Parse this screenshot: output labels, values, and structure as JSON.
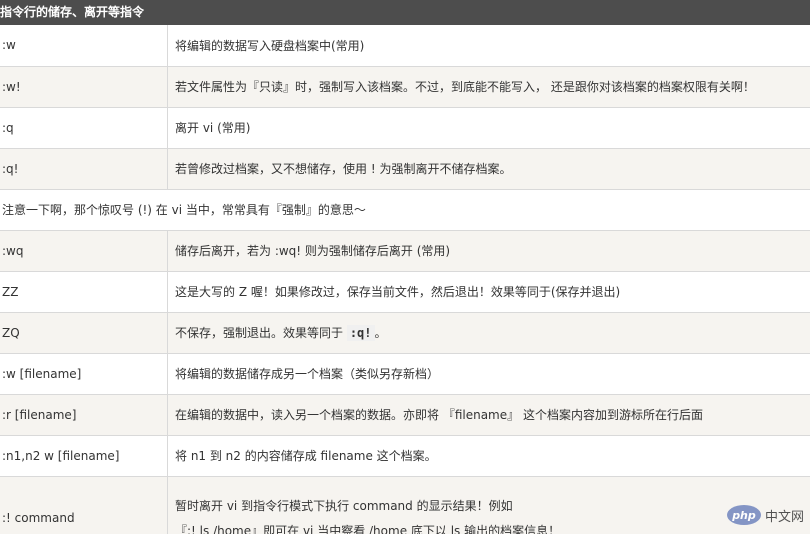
{
  "header": {
    "title": "指令行的储存、离开等指令"
  },
  "rows": [
    {
      "cmd": ":w",
      "desc": "将编辑的数据写入硬盘档案中(常用)"
    },
    {
      "cmd": ":w!",
      "desc": "若文件属性为『只读』时，强制写入该档案。不过，到底能不能写入， 还是跟你对该档案的档案权限有关啊！"
    },
    {
      "cmd": ":q",
      "desc": "离开 vi (常用)"
    },
    {
      "cmd": ":q!",
      "desc": "若曾修改过档案，又不想储存，使用 ! 为强制离开不储存档案。"
    },
    {
      "note": "注意一下啊，那个惊叹号 (!) 在 vi 当中，常常具有『强制』的意思～"
    },
    {
      "cmd": ":wq",
      "desc": "储存后离开，若为 :wq! 则为强制储存后离开 (常用)"
    },
    {
      "cmd": "ZZ",
      "desc": "这是大写的 Z 喔！如果修改过，保存当前文件，然后退出！效果等同于(保存并退出)"
    },
    {
      "cmd": "ZQ",
      "desc_before": "不保存，强制退出。效果等同于 ",
      "desc_code": ":q!",
      "desc_after": "。"
    },
    {
      "cmd": ":w [filename]",
      "desc": "将编辑的数据储存成另一个档案（类似另存新档）"
    },
    {
      "cmd": ":r [filename]",
      "desc": "在编辑的数据中，读入另一个档案的数据。亦即将 『filename』 这个档案内容加到游标所在行后面"
    },
    {
      "cmd": ":n1,n2 w [filename]",
      "desc": "将 n1 到 n2 的内容储存成 filename 这个档案。"
    },
    {
      "cmd": ":! command",
      "desc": "暂时离开 vi 到指令行模式下执行 command 的显示结果！例如",
      "desc_line2": "『:! ls /home』即可在 vi 当中察看 /home 底下以 ls 输出的档案信息！"
    }
  ],
  "watermark": {
    "logo": "php",
    "text": "中文网"
  }
}
